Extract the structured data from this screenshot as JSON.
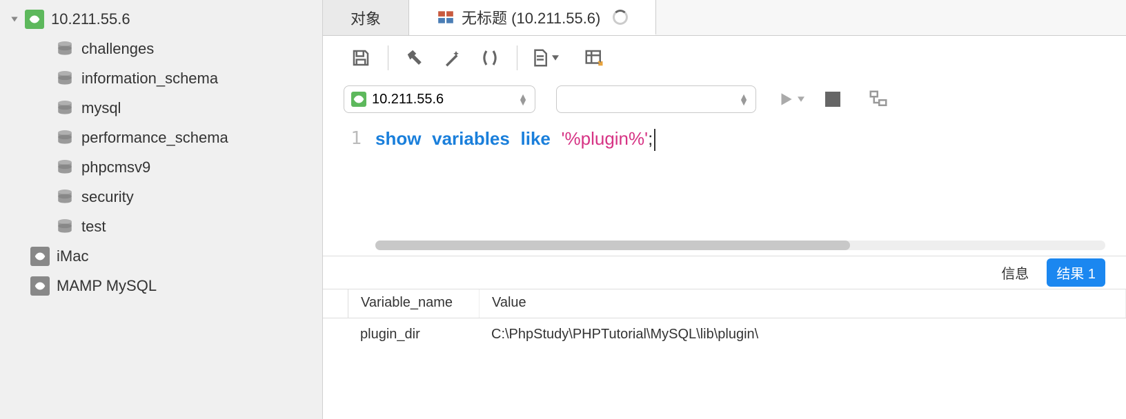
{
  "sidebar": {
    "active_connection": "10.211.55.6",
    "databases": [
      "challenges",
      "information_schema",
      "mysql",
      "performance_schema",
      "phpcmsv9",
      "security",
      "test"
    ],
    "connections": [
      "iMac",
      "MAMP MySQL"
    ]
  },
  "tabs": {
    "obj": "对象",
    "query": "无标题 (10.211.55.6)"
  },
  "selectors": {
    "connection": "10.211.55.6"
  },
  "editor": {
    "line_no": "1",
    "kw1": "show",
    "kw2": "variables",
    "kw3": "like",
    "str": "'%plugin%'",
    "semi": ";"
  },
  "results_tabs": {
    "info": "信息",
    "result1": "结果 1"
  },
  "table": {
    "columns": [
      "Variable_name",
      "Value"
    ],
    "rows": [
      {
        "name": "plugin_dir",
        "value": "C:\\PhpStudy\\PHPTutorial\\MySQL\\lib\\plugin\\"
      }
    ]
  }
}
